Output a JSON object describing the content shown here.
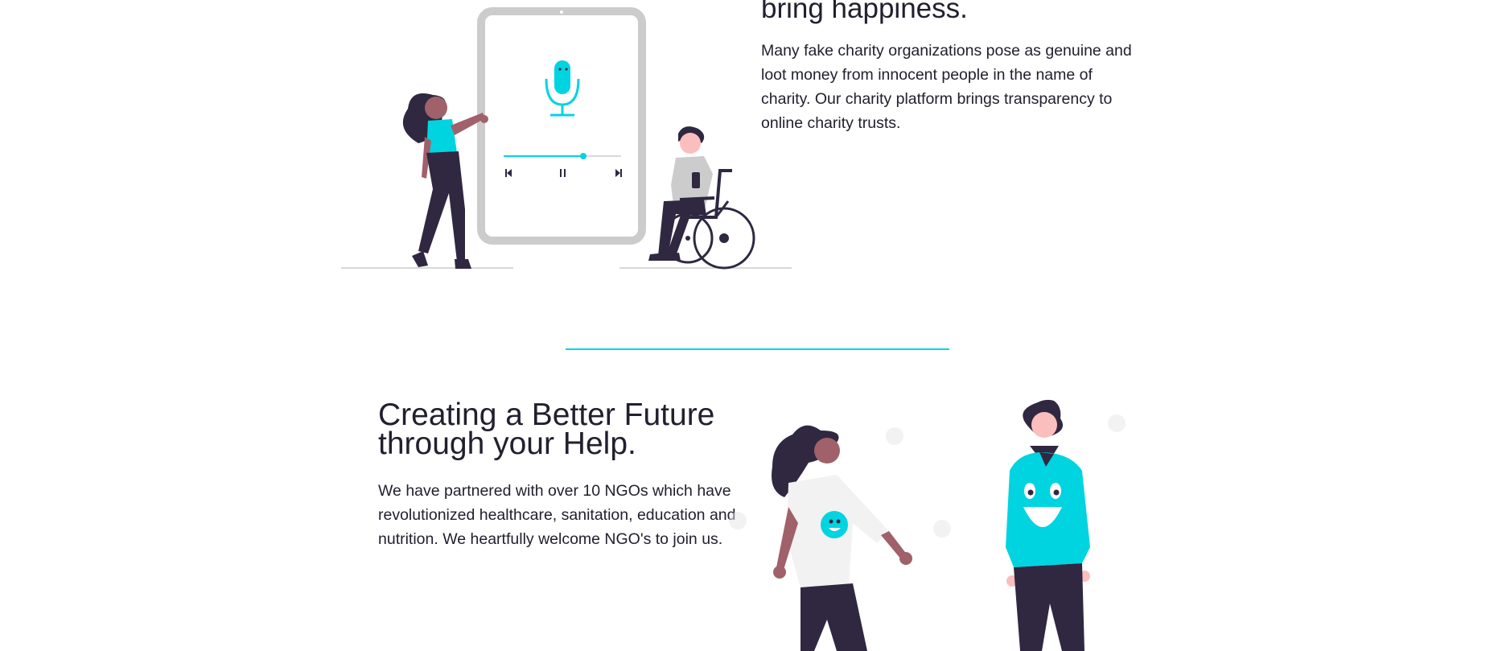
{
  "section_top": {
    "heading_tail": "bring happiness.",
    "paragraph": "Many fake charity organizations pose as genuine and loot money from innocent people in the name of charity. Our charity platform brings transparency to online charity trusts."
  },
  "section_bottom": {
    "heading_line1": "Creating a Better Future",
    "heading_line2": "through your Help.",
    "paragraph": "We have partnered with over 10 NGOs which have revolutionized healthcare, sanitation, education and nutrition. We heartfully welcome NGO's to join us."
  },
  "colors": {
    "accent": "#00d4e0",
    "text": "#22202e",
    "gray": "#cccccc",
    "dark": "#2f2840",
    "skin": "#a0616a",
    "skin_light": "#fbbebe"
  },
  "icons": {
    "mic": "microphone-icon",
    "prev": "skip-back-icon",
    "pause": "pause-icon",
    "next": "skip-forward-icon"
  }
}
